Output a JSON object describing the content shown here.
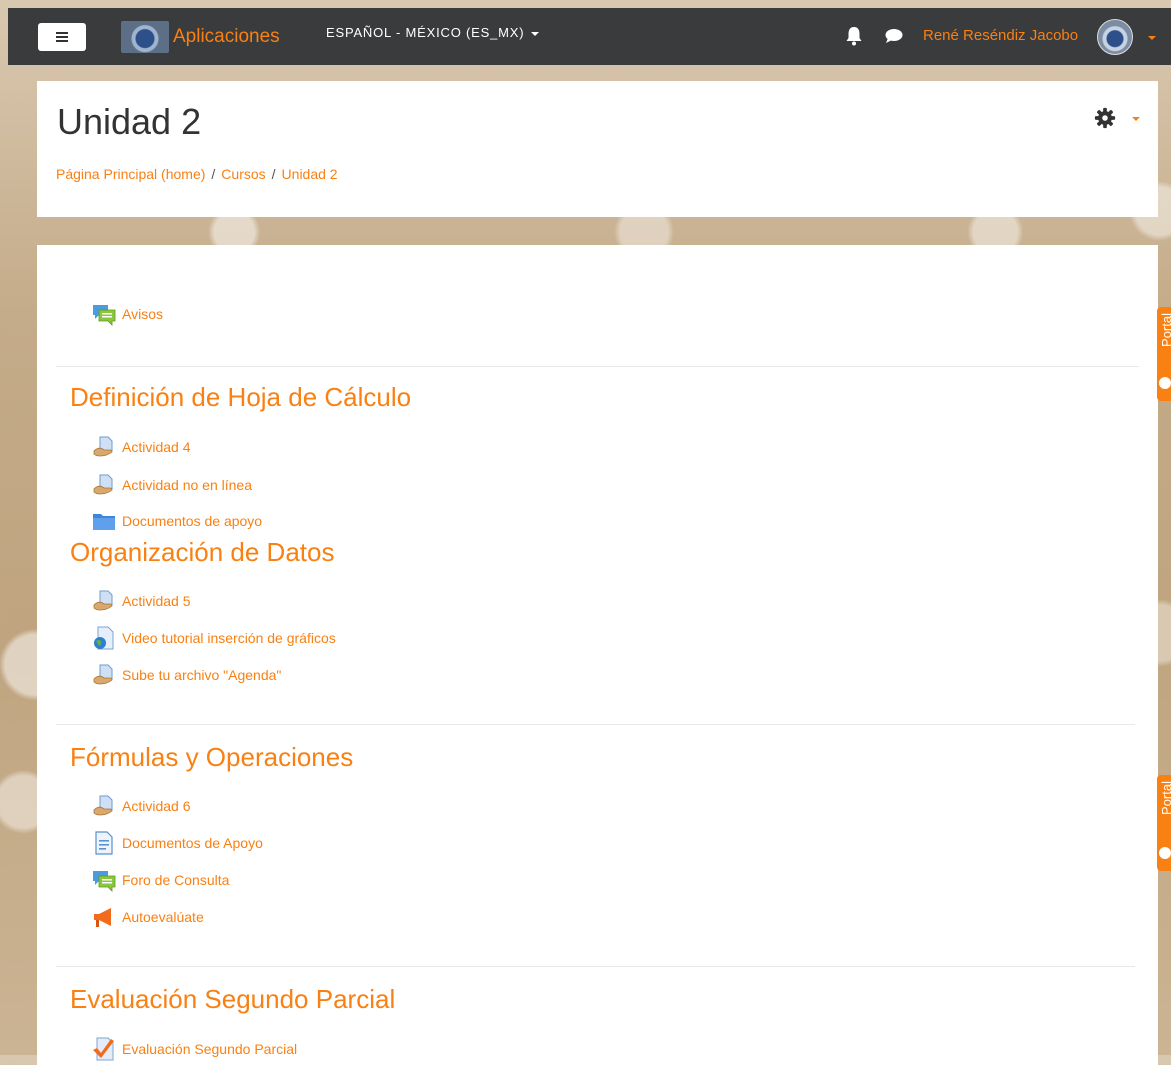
{
  "navbar": {
    "brand_name": "Aplicaciones",
    "language": "ESPAÑOL - MÉXICO (ES_MX)",
    "user_name": "René Reséndiz Jacobo"
  },
  "page": {
    "title": "Unidad 2",
    "breadcrumb": [
      "Página Principal (home)",
      "Cursos",
      "Unidad 2"
    ]
  },
  "general_section": {
    "activities": [
      {
        "icon": "forum-icon",
        "label": "Avisos"
      }
    ]
  },
  "sections": [
    {
      "title": "Definición de Hoja de Cálculo",
      "activities": [
        {
          "icon": "assignment-icon",
          "label": "Actividad 4"
        },
        {
          "icon": "assignment-icon",
          "label": "Actividad no en línea"
        },
        {
          "icon": "folder-icon",
          "label": "Documentos de apoyo"
        }
      ]
    },
    {
      "title": "Organización de Datos",
      "activities": [
        {
          "icon": "assignment-icon",
          "label": "Actividad 5"
        },
        {
          "icon": "url-icon",
          "label": "Video tutorial inserción de gráficos"
        },
        {
          "icon": "assignment-icon",
          "label": "Sube tu archivo \"Agenda\""
        }
      ]
    },
    {
      "title": "Fórmulas y Operaciones",
      "activities": [
        {
          "icon": "assignment-icon",
          "label": "Actividad 6"
        },
        {
          "icon": "page-icon",
          "label": "Documentos de Apoyo"
        },
        {
          "icon": "forum-icon",
          "label": "Foro de Consulta"
        },
        {
          "icon": "feedback-icon",
          "label": "Autoevalúate"
        }
      ]
    },
    {
      "title": "Evaluación Segundo Parcial",
      "activities": [
        {
          "icon": "quiz-icon",
          "label": "Evaluación Segundo Parcial"
        }
      ]
    }
  ],
  "side_tabs": [
    "Portal",
    "Portal"
  ],
  "colors": {
    "accent": "#f98012",
    "navbar_bg": "#393b3c",
    "card_bg": "#ffffff",
    "title_text": "#333333"
  }
}
